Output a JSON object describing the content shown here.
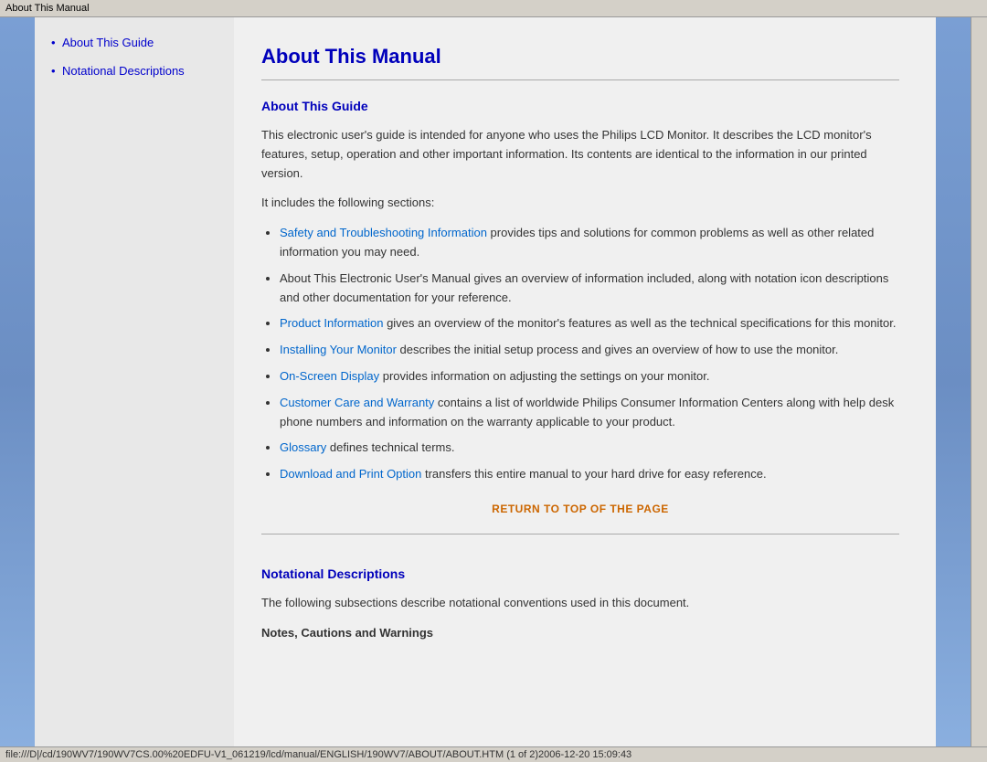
{
  "titleBar": {
    "text": "About This Manual"
  },
  "sidebar": {
    "navItems": [
      {
        "label": "About This Guide",
        "href": "#about-guide"
      },
      {
        "label": "Notational Descriptions",
        "href": "#notational"
      }
    ]
  },
  "content": {
    "pageTitle": "About This Manual",
    "sections": [
      {
        "id": "about-guide",
        "title": "About This Guide",
        "paragraphs": [
          "This electronic user's guide is intended for anyone who uses the Philips LCD Monitor. It describes the LCD monitor's features, setup, operation and other important information. Its contents are identical to the information in our printed version.",
          "It includes the following sections:"
        ],
        "bullets": [
          {
            "linkText": "Safety and Troubleshooting Information",
            "restText": " provides tips and solutions for common problems as well as other related information you may need."
          },
          {
            "linkText": null,
            "restText": "About This Electronic User's Manual gives an overview of information included, along with notation icon descriptions and other documentation for your reference."
          },
          {
            "linkText": "Product Information",
            "restText": " gives an overview of the monitor's features as well as the technical specifications for this monitor."
          },
          {
            "linkText": "Installing Your Monitor",
            "restText": " describes the initial setup process and gives an overview of how to use the monitor."
          },
          {
            "linkText": "On-Screen Display",
            "restText": " provides information on adjusting the settings on your monitor."
          },
          {
            "linkText": "Customer Care and Warranty",
            "restText": " contains a list of worldwide Philips Consumer Information Centers along with help desk phone numbers and information on the warranty applicable to your product."
          },
          {
            "linkText": "Glossary",
            "restText": " defines technical terms."
          },
          {
            "linkText": "Download and Print Option",
            "restText": " transfers this entire manual to your hard drive for easy reference."
          }
        ],
        "returnLink": "RETURN TO TOP OF THE PAGE"
      },
      {
        "id": "notational",
        "title": "Notational Descriptions",
        "paragraphs": [
          "The following subsections describe notational conventions used in this document."
        ],
        "boldText": "Notes, Cautions and Warnings"
      }
    ]
  },
  "statusBar": {
    "text": "file:///D|/cd/190WV7/190WV7CS.00%20EDFU-V1_061219/lcd/manual/ENGLISH/190WV7/ABOUT/ABOUT.HTM (1 of 2)2006-12-20 15:09:43"
  }
}
